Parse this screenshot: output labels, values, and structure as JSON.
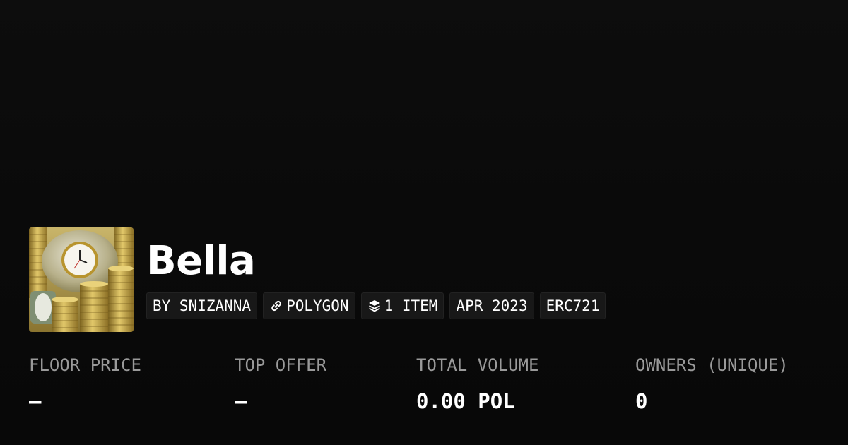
{
  "collection": {
    "name": "Bella",
    "creator_label": "BY SNIZANNA",
    "chain": "POLYGON",
    "item_count": "1 ITEM",
    "created": "APR 2023",
    "standard": "ERC721",
    "chain_icon": "polygon-link-icon",
    "items_icon": "stack-layers-icon",
    "thumbnail": "clock-and-gold-coins-image"
  },
  "stats": [
    {
      "label": "FLOOR PRICE",
      "value": "–"
    },
    {
      "label": "TOP OFFER",
      "value": "–"
    },
    {
      "label": "TOTAL VOLUME",
      "value": "0.00 POL"
    },
    {
      "label": "OWNERS (UNIQUE)",
      "value": "0"
    }
  ],
  "colors": {
    "background": "#0a0a0a",
    "chip_background": "#181818",
    "label_gray": "#9a9a9a",
    "text": "#ffffff"
  }
}
